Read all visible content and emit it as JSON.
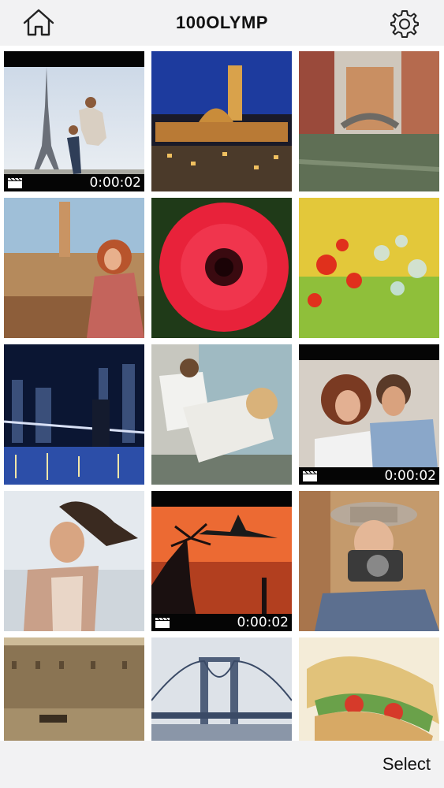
{
  "header": {
    "title": "100OLYMP",
    "left_icon": "home-icon",
    "right_icon": "gear-icon"
  },
  "photos": [
    {
      "name": "tile-eiffel-tower",
      "video": true,
      "duration": "0:00:02"
    },
    {
      "name": "tile-siena-night",
      "video": false
    },
    {
      "name": "tile-venice-canal",
      "video": false
    },
    {
      "name": "tile-florence-woman",
      "video": false
    },
    {
      "name": "tile-red-gerbera",
      "video": false
    },
    {
      "name": "tile-poppy-field",
      "video": false
    },
    {
      "name": "tile-brooklyn-bridge",
      "video": false
    },
    {
      "name": "tile-two-women",
      "video": false
    },
    {
      "name": "tile-couple",
      "video": true,
      "duration": "0:00:02"
    },
    {
      "name": "tile-beach-woman",
      "video": false
    },
    {
      "name": "tile-airplane-sunset",
      "video": true,
      "duration": "0:00:02"
    },
    {
      "name": "tile-photographer",
      "video": false
    },
    {
      "name": "tile-venice-sepia",
      "video": false
    },
    {
      "name": "tile-suspension-bridge",
      "video": false
    },
    {
      "name": "tile-sandwich",
      "video": false
    }
  ],
  "footer": {
    "select_label": "Select"
  },
  "colors": {
    "bar_background": "#f2f2f3",
    "video_strip": "#050505"
  }
}
